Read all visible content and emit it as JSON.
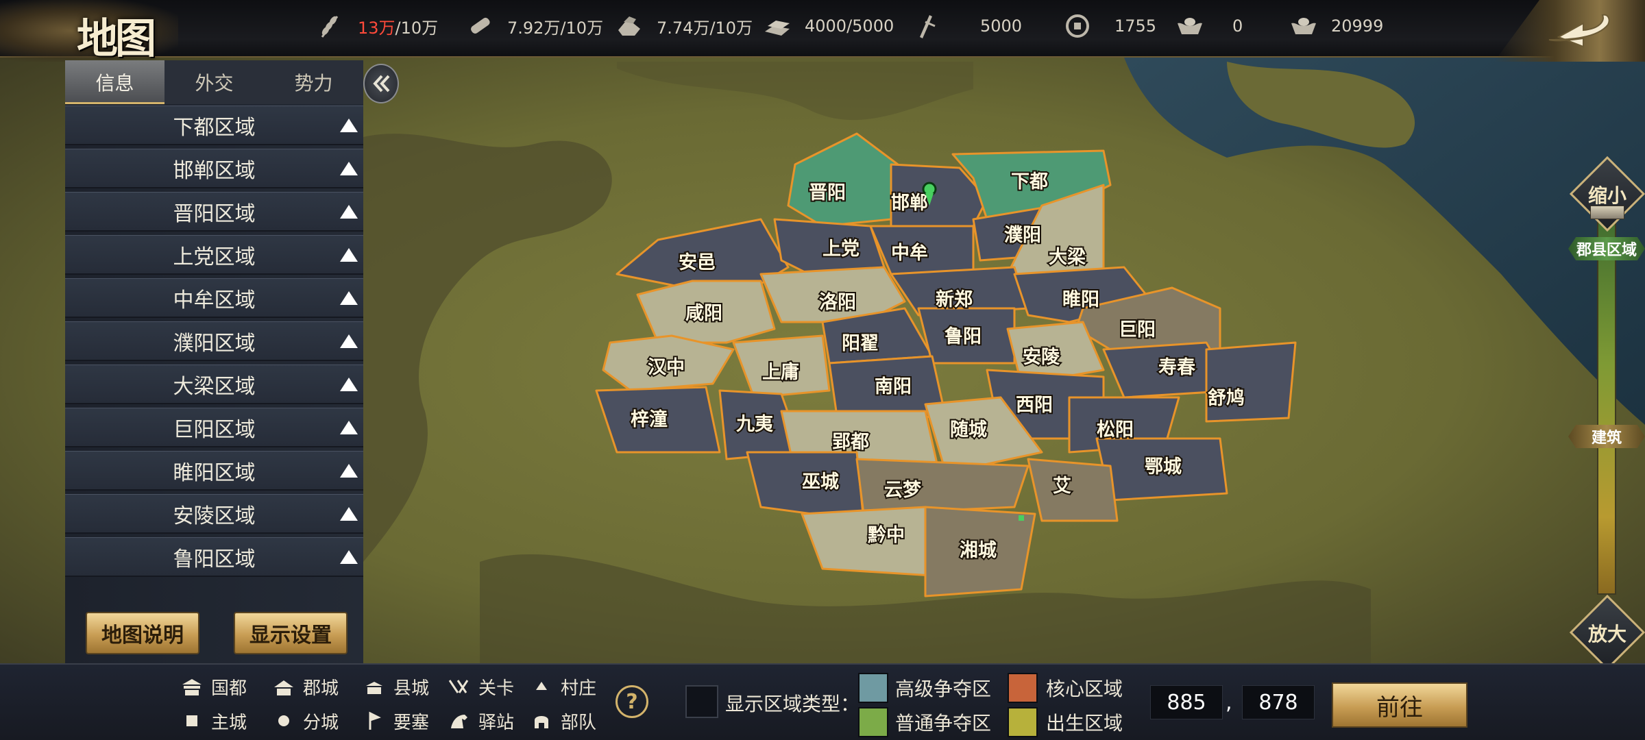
{
  "top_bar": {
    "title": "地图",
    "resources": [
      {
        "icon": "grain-icon",
        "current": "13万",
        "max": "/10万",
        "over_limit": true
      },
      {
        "icon": "wood-icon",
        "current": "7.92万",
        "max": "/10万",
        "over_limit": false
      },
      {
        "icon": "stone-icon",
        "current": "7.74万",
        "max": "/10万",
        "over_limit": false
      },
      {
        "icon": "iron-icon",
        "current": "4000",
        "max": "/5000",
        "over_limit": false
      },
      {
        "icon": "order-icon",
        "current": "5000",
        "max": "",
        "over_limit": false
      },
      {
        "icon": "coin-icon",
        "current": "1755",
        "max": "",
        "over_limit": false
      },
      {
        "icon": "gold-ingot-icon",
        "current": "0",
        "max": "",
        "over_limit": false
      },
      {
        "icon": "silver-ingot-icon",
        "current": "20999",
        "max": "",
        "over_limit": false
      }
    ]
  },
  "left_panel": {
    "tabs": [
      {
        "label": "信息",
        "active": true
      },
      {
        "label": "外交",
        "active": false
      },
      {
        "label": "势力",
        "active": false
      }
    ],
    "regions": [
      "下都区域",
      "邯郸区域",
      "晋阳区域",
      "上党区域",
      "中牟区域",
      "濮阳区域",
      "大梁区域",
      "巨阳区域",
      "睢阳区域",
      "安陵区域",
      "鲁阳区域"
    ],
    "map_help_label": "地图说明",
    "display_settings_label": "显示设置"
  },
  "map": {
    "cities": [
      "晋阳",
      "邯郸",
      "下都",
      "安邑",
      "上党",
      "中牟",
      "濮阳",
      "大梁",
      "咸阳",
      "洛阳",
      "新郑",
      "睢阳",
      "巨阳",
      "阳翟",
      "鲁阳",
      "安陵",
      "汉中",
      "上庸",
      "南阳",
      "寿春",
      "舒鸠",
      "梓潼",
      "九夷",
      "西阳",
      "郢都",
      "随城",
      "松阳",
      "鄂城",
      "巫城",
      "云梦",
      "艾",
      "黔中",
      "湘城"
    ]
  },
  "zoom": {
    "zoom_out_label": "缩小",
    "zoom_in_label": "放大",
    "level_county": "郡县区域",
    "level_building": "建筑"
  },
  "legend": [
    {
      "icon": "capital-icon",
      "label": "国都"
    },
    {
      "icon": "commandery-icon",
      "label": "郡城"
    },
    {
      "icon": "county-icon",
      "label": "县城"
    },
    {
      "icon": "pass-icon",
      "label": "关卡"
    },
    {
      "icon": "village-icon",
      "label": "村庄"
    },
    {
      "icon": "main-city-icon",
      "label": "主城"
    },
    {
      "icon": "branch-city-icon",
      "label": "分城"
    },
    {
      "icon": "fortress-icon",
      "label": "要塞"
    },
    {
      "icon": "post-station-icon",
      "label": "驿站"
    },
    {
      "icon": "troop-icon",
      "label": "部队"
    }
  ],
  "region_types": {
    "label": "显示区域类型：",
    "items": [
      {
        "label": "高级争夺区",
        "color": "#6f9aa2"
      },
      {
        "label": "核心区域",
        "color": "#c8643a"
      },
      {
        "label": "普通争夺区",
        "color": "#7cab48"
      },
      {
        "label": "出生区域",
        "color": "#b7b13b"
      }
    ]
  },
  "coords": {
    "x": "885",
    "separator": ",",
    "y": "878"
  },
  "go_label": "前往",
  "colors": {
    "gold": "#d3b36b",
    "panel": "#262c38",
    "slate_region": "#4b5060",
    "beige_region": "#b7b393",
    "green_region": "#4e9a74"
  }
}
